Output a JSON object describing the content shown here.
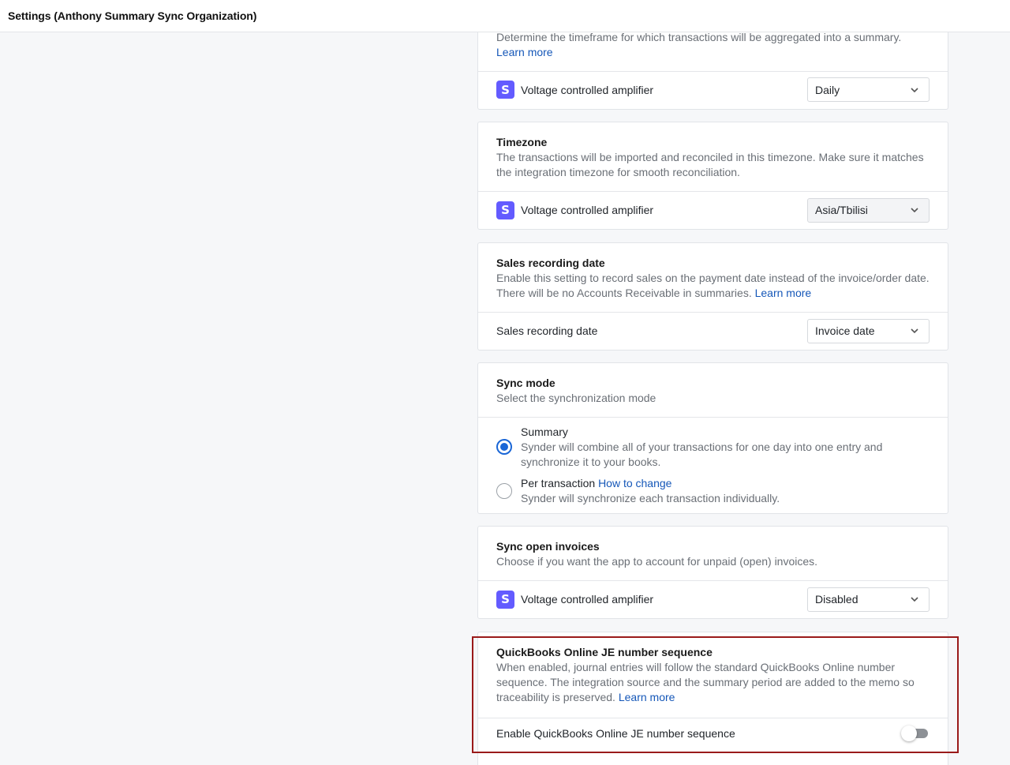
{
  "header": {
    "title": "Settings (Anthony Summary Sync Organization)"
  },
  "summary_period": {
    "desc": "Determine the timeframe for which transactions will be aggregated into a summary.",
    "learn_more": "Learn more",
    "source_name": "Voltage controlled amplifier",
    "value": "Daily"
  },
  "timezone": {
    "title": "Timezone",
    "desc": "The transactions will be imported and reconciled in this timezone. Make sure it matches the integration timezone for smooth reconciliation.",
    "source_name": "Voltage controlled amplifier",
    "value": "Asia/Tbilisi"
  },
  "sales_recording": {
    "title": "Sales recording date",
    "desc": "Enable this setting to record sales on the payment date instead of the invoice/order date. There will be no Accounts Receivable in summaries.",
    "learn_more": "Learn more",
    "row_label": "Sales recording date",
    "value": "Invoice date"
  },
  "sync_mode": {
    "title": "Sync mode",
    "desc": "Select the synchronization mode",
    "options": [
      {
        "label": "Summary",
        "desc": "Synder will combine all of your transactions for one day into one entry and synchronize it to your books.",
        "checked": true
      },
      {
        "label": "Per transaction",
        "link": "How to change",
        "desc": "Synder will synchronize each transaction individually.",
        "checked": false
      }
    ]
  },
  "sync_open_invoices": {
    "title": "Sync open invoices",
    "desc": "Choose if you want the app to account for unpaid (open) invoices.",
    "source_name": "Voltage controlled amplifier",
    "value": "Disabled"
  },
  "je_sequence": {
    "title": "QuickBooks Online JE number sequence",
    "desc": "When enabled, journal entries will follow the standard QuickBooks Online number sequence. The integration source and the summary period are added to the memo so traceability is preserved.",
    "learn_more": "Learn more",
    "toggle_label": "Enable QuickBooks Online JE number sequence",
    "enabled": false
  },
  "colors": {
    "accent": "#1a66d6",
    "link": "#1557b8",
    "logo": "#635bff",
    "highlight": "#9a1a1a"
  }
}
